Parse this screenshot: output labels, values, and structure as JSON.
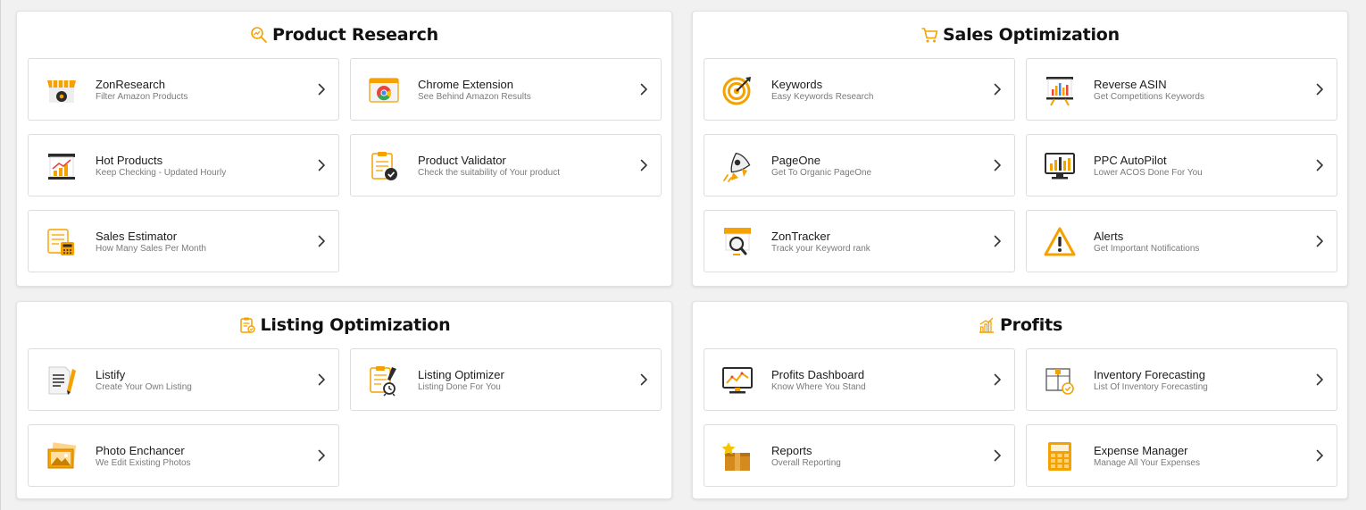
{
  "colors": {
    "accent": "#f5a100",
    "dark": "#2b2b2b"
  },
  "sections": {
    "product_research": {
      "title": "Product Research",
      "title_icon": "search-chart-icon",
      "items": [
        {
          "label": "ZonResearch",
          "sub": "Filter Amazon Products",
          "icon": "storefront-icon"
        },
        {
          "label": "Chrome Extension",
          "sub": "See Behind Amazon Results",
          "icon": "chrome-browser-icon"
        },
        {
          "label": "Hot Products",
          "sub": "Keep Checking - Updated Hourly",
          "icon": "trending-chart-icon"
        },
        {
          "label": "Product Validator",
          "sub": "Check the suitability of Your product",
          "icon": "clipboard-check-icon"
        },
        {
          "label": "Sales Estimator",
          "sub": "How Many Sales Per Month",
          "icon": "calculator-sheet-icon"
        }
      ]
    },
    "sales_optimization": {
      "title": "Sales Optimization",
      "title_icon": "cart-icon",
      "items": [
        {
          "label": "Keywords",
          "sub": "Easy Keywords Research",
          "icon": "target-icon"
        },
        {
          "label": "Reverse ASIN",
          "sub": "Get Competitions Keywords",
          "icon": "presentation-chart-icon"
        },
        {
          "label": "PageOne",
          "sub": "Get To Organic PageOne",
          "icon": "rocket-icon"
        },
        {
          "label": "PPC AutoPilot",
          "sub": "Lower ACOS Done For You",
          "icon": "monitor-chart-icon"
        },
        {
          "label": "ZonTracker",
          "sub": "Track your Keyword rank",
          "icon": "magnifier-screen-icon"
        },
        {
          "label": "Alerts",
          "sub": "Get Important Notifications",
          "icon": "warning-icon"
        }
      ]
    },
    "listing_optimization": {
      "title": "Listing Optimization",
      "title_icon": "clipboard-icon",
      "items": [
        {
          "label": "Listify",
          "sub": "Create Your Own Listing",
          "icon": "document-pencil-icon"
        },
        {
          "label": "Listing Optimizer",
          "sub": "Listing Done For You",
          "icon": "clipboard-clock-icon"
        },
        {
          "label": "Photo Enchancer",
          "sub": "We Edit Existing Photos",
          "icon": "photo-icon"
        }
      ]
    },
    "profits": {
      "title": "Profits",
      "title_icon": "bar-chart-icon",
      "items": [
        {
          "label": "Profits Dashboard",
          "sub": "Know Where You Stand",
          "icon": "dashboard-monitor-icon"
        },
        {
          "label": "Inventory Forecasting",
          "sub": "List Of Inventory Forecasting",
          "icon": "inventory-box-icon"
        },
        {
          "label": "Reports",
          "sub": "Overall Reporting",
          "icon": "report-box-icon"
        },
        {
          "label": "Expense Manager",
          "sub": "Manage All Your Expenses",
          "icon": "calculator-icon"
        }
      ]
    }
  }
}
